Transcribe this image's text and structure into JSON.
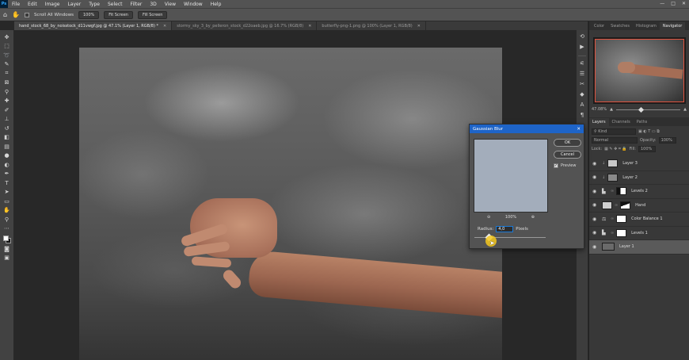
{
  "app": {
    "logo": "Ps"
  },
  "menu": [
    "File",
    "Edit",
    "Image",
    "Layer",
    "Type",
    "Select",
    "Filter",
    "3D",
    "View",
    "Window",
    "Help"
  ],
  "window_controls": [
    "—",
    "□",
    "✕"
  ],
  "options_bar": {
    "scroll_all_label": "Scroll All Windows",
    "zoom_value": "100%",
    "fit_screen_label": "Fit Screen",
    "fill_screen_label": "Fill Screen"
  },
  "tabs": [
    {
      "label": "hand_stock_68_by_noisstock_d11vwgf.jpg @ 47.1% (Layer 1, RGB/8) *",
      "active": true
    },
    {
      "label": "stormy_sky_3_by_pelleron_stock_d22oaeb.jpg @ 16.7% (RGB/8)",
      "active": false
    },
    {
      "label": "butterfly-png-1.png @ 100% (Layer 1, RGB/8)",
      "active": false
    }
  ],
  "tab_close": "✕",
  "toolbar_icons": [
    "move-icon",
    "marquee-icon",
    "lasso-icon",
    "quick-select-icon",
    "crop-icon",
    "frame-icon",
    "eyedropper-icon",
    "healing-icon",
    "brush-icon",
    "stamp-icon",
    "history-brush-icon",
    "eraser-icon",
    "gradient-icon",
    "blur-icon",
    "dodge-icon",
    "pen-icon",
    "type-icon",
    "path-select-icon",
    "rectangle-icon",
    "hand-icon",
    "zoom-icon",
    "more-icon"
  ],
  "top_panel": {
    "tabs": [
      "Color",
      "Swatches",
      "Histogram",
      "Navigator"
    ],
    "active_tab": "Navigator",
    "zoom_readout": "47.08%"
  },
  "layers_panel": {
    "tabs": [
      "Layers",
      "Channels",
      "Paths"
    ],
    "active_tab": "Layers",
    "filter_label": "Kind",
    "blend_mode": "Normal",
    "opacity_label": "Opacity:",
    "opacity_value": "100%",
    "lock_label": "Lock:",
    "fill_label": "Fill:",
    "fill_value": "100%",
    "layers": [
      {
        "name": "Layer 3",
        "thumb": "#c8c8c8",
        "mask": false,
        "selected": false
      },
      {
        "name": "Layer 2",
        "thumb": "#8a8a8a",
        "mask": false,
        "selected": false
      },
      {
        "name": "Levels 2",
        "thumb": "",
        "mask": true,
        "selected": false
      },
      {
        "name": "Hand",
        "thumb": "#b88266",
        "mask": true,
        "selected": false
      },
      {
        "name": "Color Balance 1",
        "thumb": "",
        "mask": true,
        "selected": false
      },
      {
        "name": "Levels 1",
        "thumb": "",
        "mask": true,
        "selected": false
      },
      {
        "name": "Layer 1",
        "thumb": "#6a6a6a",
        "mask": false,
        "selected": true
      }
    ]
  },
  "dialog": {
    "title": "Gaussian Blur",
    "ok_label": "OK",
    "cancel_label": "Cancel",
    "preview_label": "Preview",
    "preview_checked": true,
    "zoom_value": "100%",
    "radius_label": "Radius:",
    "radius_value": "4,0",
    "radius_unit": "Pixels"
  },
  "colors": {
    "dialog_title_bar": "#1e64c8",
    "navigator_frame": "#e0533f",
    "cursor_highlight": "#f5c81e"
  }
}
